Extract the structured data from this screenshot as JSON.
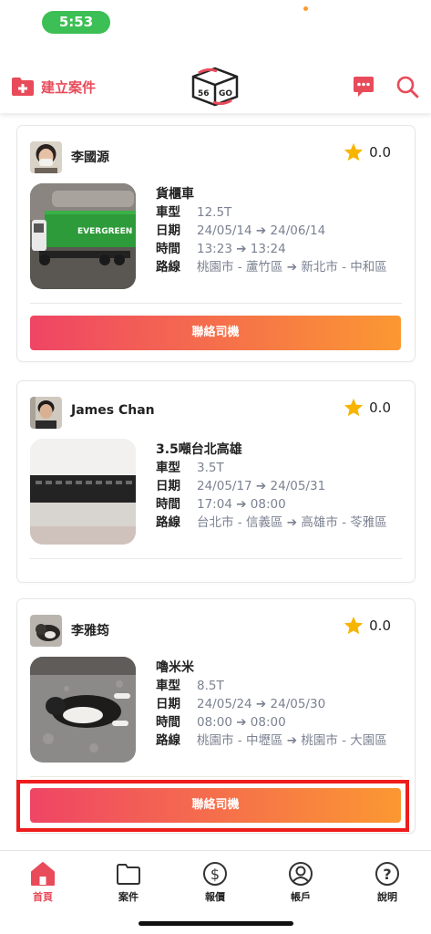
{
  "status": {
    "time": "5:53"
  },
  "header": {
    "create_label": "建立案件"
  },
  "cards": [
    {
      "driver": "李國源",
      "rating": "0.0",
      "title": "貨櫃車",
      "rows": [
        {
          "k": "車型",
          "v": "12.5T"
        },
        {
          "k": "日期",
          "v": "24/05/14 ➔ 24/06/14"
        },
        {
          "k": "時間",
          "v": "13:23 ➔ 13:24"
        },
        {
          "k": "路線",
          "v": "桃園市 - 蘆竹區 ➔ 新北市 - 中和區"
        }
      ],
      "button": "聯絡司機",
      "thumb_text": "EVERGREEN"
    },
    {
      "driver": "James Chan",
      "rating": "0.0",
      "title": "3.5噸台北高雄",
      "rows": [
        {
          "k": "車型",
          "v": "3.5T"
        },
        {
          "k": "日期",
          "v": "24/05/17 ➔ 24/05/31"
        },
        {
          "k": "時間",
          "v": "17:04 ➔ 08:00"
        },
        {
          "k": "路線",
          "v": "台北市 - 信義區 ➔ 高雄市 - 苓雅區"
        }
      ]
    },
    {
      "driver": "李雅筠",
      "rating": "0.0",
      "title": "嚕米米",
      "rows": [
        {
          "k": "車型",
          "v": "8.5T"
        },
        {
          "k": "日期",
          "v": "24/05/24 ➔ 24/05/30"
        },
        {
          "k": "時間",
          "v": "08:00 ➔ 08:00"
        },
        {
          "k": "路線",
          "v": "桃園市 - 中壢區 ➔ 桃園市 - 大園區"
        }
      ],
      "button": "聯絡司機"
    }
  ],
  "nav": [
    {
      "label": "首頁",
      "icon": "home-icon",
      "active": true
    },
    {
      "label": "案件",
      "icon": "folder-icon",
      "active": false
    },
    {
      "label": "報價",
      "icon": "dollar-icon",
      "active": false
    },
    {
      "label": "帳戶",
      "icon": "user-icon",
      "active": false
    },
    {
      "label": "說明",
      "icon": "help-icon",
      "active": false
    }
  ],
  "colors": {
    "accent": "#e84b5a",
    "gradient_start": "#ef4565",
    "gradient_end": "#fb9832",
    "highlight": "#ee1c1c"
  }
}
